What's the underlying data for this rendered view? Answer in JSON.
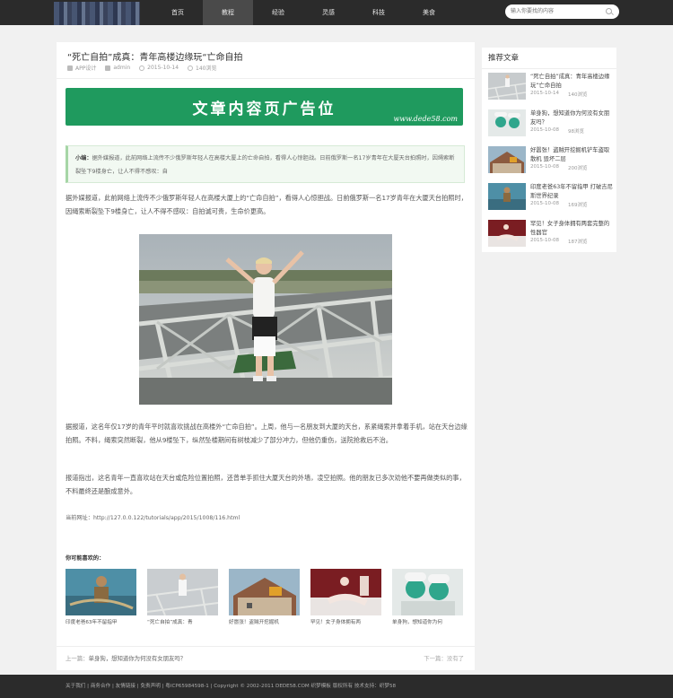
{
  "header": {
    "nav": [
      "首页",
      "教程",
      "经验",
      "灵感",
      "科技",
      "美食"
    ],
    "active_nav": "教程",
    "search_placeholder": "输入你要找的内容"
  },
  "article": {
    "title": "“死亡自拍”成真：青年高楼边缘玩“亡命自拍",
    "category": "APP设计",
    "author": "admin",
    "date": "2015-10-14",
    "views": "140浏览",
    "ad_text": "文章内容页广告位",
    "ad_url": "www.dede58.com",
    "summary_label": "小编：",
    "summary_text": "据外媒报道，此前网络上流传不少俄罗斯年轻人在高楼大厦上的亡命自拍，看得人心惊胆战。日前俄罗斯一名17岁青年在大厦天台拍照时，因绳索断裂坠下9楼身亡，让人不得不感叹：自",
    "para1": "据外媒报道，此前网络上流传不少俄罗斯年轻人在高楼大厦上的“亡命自拍”，看得人心惊胆战。日前俄罗斯一名17岁青年在大厦天台拍照时，因绳索断裂坠下9楼身亡，让人不得不感叹：自拍诚可贵，生命价更高。",
    "para2": "据报道，这名年仅17岁的青年平时就喜欢挑战在高楼外“亡命自拍”。上周，他与一名朋友到大厦的天台，系紧绳索并拿着手机，站在天台边缘拍照。不料，绳索突然断裂，他从9楼坠下，纵然坠楼期间有树枝减少了部分冲力，但他仍重伤，送院抢救后不治。",
    "para3": "报道指出，这名青年一直喜欢站在天台或危险位置拍照，还曾单手抓住大厦天台的外墙，凌空拍照。他的朋友已多次劝他不要再做类似的事，不料最终还是酿成意外。",
    "url_label": "当前网址：",
    "url": "http://127.0.0.122/tutorials/app/2015/1008/116.html",
    "like_heading": "你可能喜欢的：",
    "related": [
      "印度老爸63年不留指甲",
      "“死亡自拍”成真：青",
      "好嚣张！盗贼开挖掘机",
      "罕见！女子身体拥有两",
      "单身狗，想知道你为何"
    ],
    "prev_label": "上一篇：",
    "prev_title": "单身狗，想知道你为何没有女朋友吗？",
    "next_text": "下一篇：没有了"
  },
  "sidebar": {
    "title": "推荐文章",
    "items": [
      {
        "title": "“死亡自拍”成真：青年高楼边缘玩“亡命自拍",
        "date": "2015-10-14",
        "views": "140浏览"
      },
      {
        "title": "单身狗，想知道你为何没有女朋友吗？",
        "date": "2015-10-08",
        "views": "98浏览"
      },
      {
        "title": "好嚣张！盗贼开挖掘机铲车盗取散机 毁坏二层",
        "date": "2015-10-08",
        "views": "200浏览"
      },
      {
        "title": "印度老爸63年不留指甲 打破吉尼斯世界纪录",
        "date": "2015-10-08",
        "views": "169浏览"
      },
      {
        "title": "罕见！女子身体拥有两套完整的性器官",
        "date": "2015-10-08",
        "views": "187浏览"
      }
    ]
  },
  "footer": {
    "text": "关于我们 | 商务合作 | 友情链接 | 免责声明 | 粤ICP65984598-1 | Copyright © 2002-2011 DEDE58.COM 织梦模板 版权所有 技术支持：织梦58"
  }
}
